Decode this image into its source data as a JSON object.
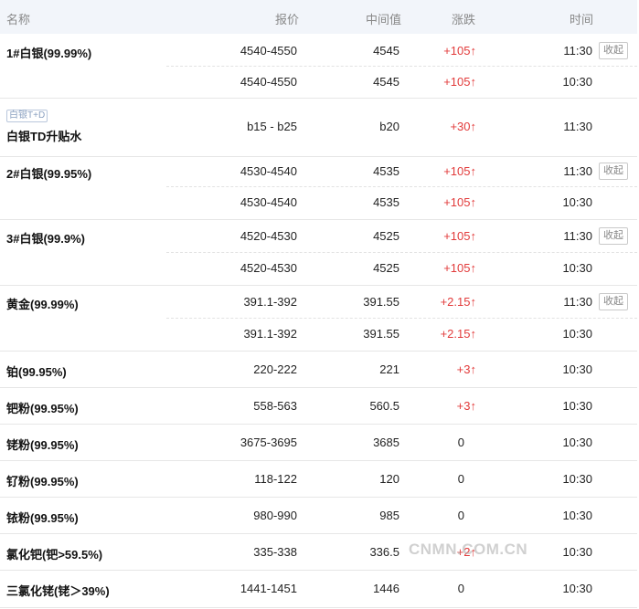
{
  "header": {
    "name": "名称",
    "quote": "报价",
    "mid": "中间值",
    "change": "涨跌",
    "time": "时间"
  },
  "rows": [
    {
      "name": "1#白银(99.99%)",
      "quote": "4540-4550",
      "mid": "4545",
      "change": "+105↑",
      "time": "11:30",
      "fold": "收起"
    },
    {
      "name": "",
      "quote": "4540-4550",
      "mid": "4545",
      "change": "+105↑",
      "time": "10:30"
    },
    {
      "tag": "白银T+D",
      "name": "白银TD升贴水",
      "quote": "b15 - b25",
      "mid": "b20",
      "change": "+30↑",
      "time": "11:30"
    },
    {
      "name": "2#白银(99.95%)",
      "quote": "4530-4540",
      "mid": "4535",
      "change": "+105↑",
      "time": "11:30",
      "fold": "收起"
    },
    {
      "name": "",
      "quote": "4530-4540",
      "mid": "4535",
      "change": "+105↑",
      "time": "10:30"
    },
    {
      "name": "3#白银(99.9%)",
      "quote": "4520-4530",
      "mid": "4525",
      "change": "+105↑",
      "time": "11:30",
      "fold": "收起"
    },
    {
      "name": "",
      "quote": "4520-4530",
      "mid": "4525",
      "change": "+105↑",
      "time": "10:30"
    },
    {
      "name": "黄金(99.99%)",
      "quote": "391.1-392",
      "mid": "391.55",
      "change": "+2.15↑",
      "time": "11:30",
      "fold": "收起"
    },
    {
      "name": "",
      "quote": "391.1-392",
      "mid": "391.55",
      "change": "+2.15↑",
      "time": "10:30"
    },
    {
      "name": "铂(99.95%)",
      "quote": "220-222",
      "mid": "221",
      "change": "+3↑",
      "time": "10:30"
    },
    {
      "name": "钯粉(99.95%)",
      "quote": "558-563",
      "mid": "560.5",
      "change": "+3↑",
      "time": "10:30"
    },
    {
      "name": "铑粉(99.95%)",
      "quote": "3675-3695",
      "mid": "3685",
      "change": "0",
      "time": "10:30"
    },
    {
      "name": "钌粉(99.95%)",
      "quote": "118-122",
      "mid": "120",
      "change": "0",
      "time": "10:30"
    },
    {
      "name": "铱粉(99.95%)",
      "quote": "980-990",
      "mid": "985",
      "change": "0",
      "time": "10:30"
    },
    {
      "name": "氯化钯(钯>59.5%)",
      "quote": "335-338",
      "mid": "336.5",
      "change": "+2↑",
      "time": "10:30"
    },
    {
      "name": "三氯化铑(铑＞39%)",
      "quote": "1441-1451",
      "mid": "1446",
      "change": "0",
      "time": "10:30"
    }
  ],
  "watermark": "CNMN.COM.CN"
}
